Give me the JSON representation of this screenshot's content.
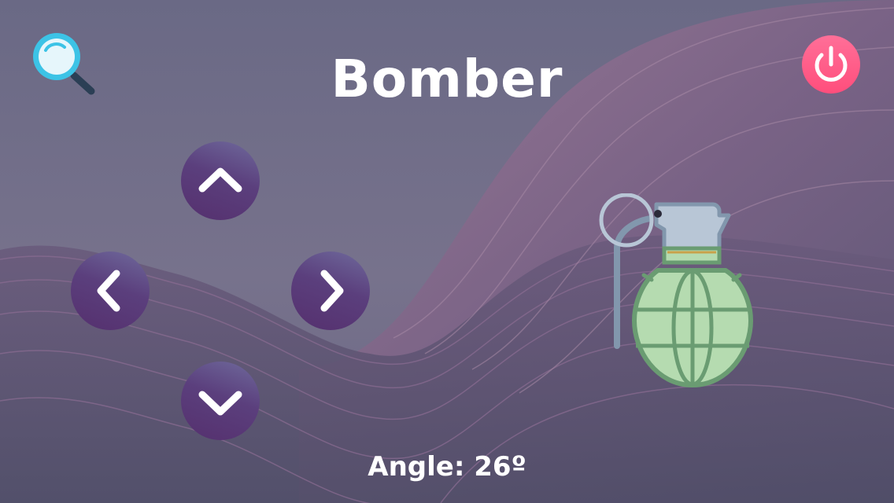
{
  "title": "Bomber",
  "angle_text": "Angle: 26º",
  "controls": {
    "up_icon": "chevron-up-icon",
    "left_icon": "chevron-left-icon",
    "right_icon": "chevron-right-icon",
    "down_icon": "chevron-down-icon"
  },
  "toolbar": {
    "search_icon": "magnifier-icon",
    "power_icon": "power-icon"
  },
  "illustration": "grenade-icon",
  "colors": {
    "background": "#6b6a86",
    "button": "#5b3f7d",
    "power": "#ff5c8a",
    "grenade_body": "#b5dbb0",
    "grenade_outline": "#6a9c72"
  }
}
